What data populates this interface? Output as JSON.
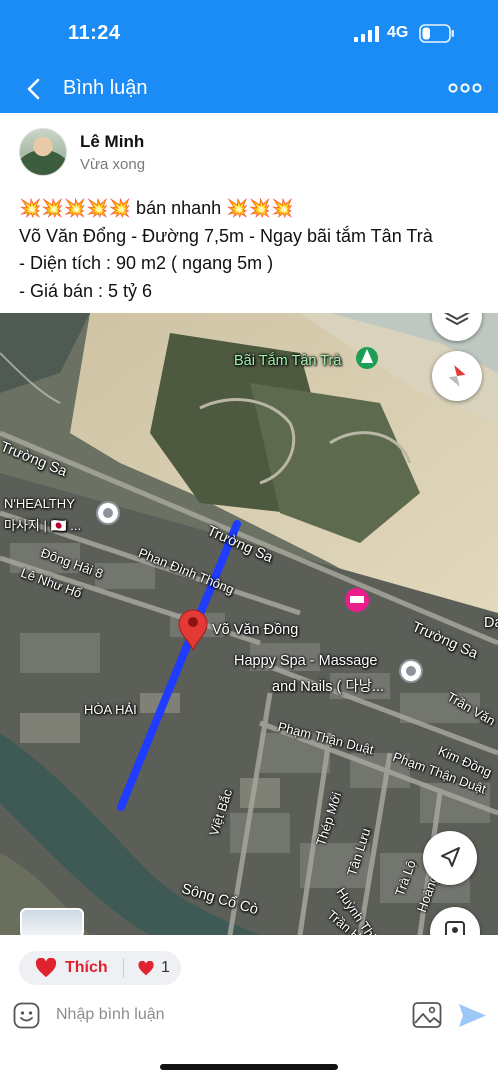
{
  "status_bar": {
    "time": "11:24",
    "network": "4G",
    "battery_level": 0.3
  },
  "header": {
    "title": "Bình luận",
    "back_icon": "chevron-left-icon",
    "more_icon": "more-dots-icon",
    "background": "#1b8cf5"
  },
  "post": {
    "author": "Lê Minh",
    "time": "Vừa xong",
    "lines": [
      "💥💥💥💥💥 bán nhanh 💥💥💥",
      "Võ Văn Đổng - Đường 7,5m - Ngay bãi tắm Tân Trà",
      "- Diện tích : 90 m2 ( ngang 5m )",
      "- Giá bán : 5 tỷ 6"
    ]
  },
  "map": {
    "labels": {
      "beach": "Bãi Tắm Tân Trà",
      "truong_sa_1": "Trường Sa",
      "truong_sa_2": "Trường Sa",
      "truong_sa_3": "Trường Sa",
      "nhealthy_1": "N'HEALTHY",
      "nhealthy_2": "마사지 | 🇯🇵 ...",
      "dong_hai": "Đông Hải 8",
      "le_nhu_ho": "Lê Như Hổ",
      "phan_dinh_thong": "Phan Đình Thông",
      "vo_van_dong": "Võ Văn Đồng",
      "happy_spa_1": "Happy Spa - Massage",
      "happy_spa_2": "and Nails ( 다낭...",
      "hoa_hai": "HÒA HẢI",
      "pham_than_duat_1": "Phạm Thận Duật",
      "pham_than_duat_2": "Phạm Thận Duật",
      "kim_dong": "Kim Đồng",
      "tran_van": "Trần Văn",
      "viet_bac": "Việt Bắc",
      "thep_moi": "Thép Mới",
      "tan_luu": "Tân Lưu",
      "song_co_co": "Sông Cổ Cò",
      "huynh_thi": "Huỳnh Thị M",
      "tran_huu": "Trần Hữu",
      "tra_lo": "Trà Lộ",
      "hoang": "Hoàng",
      "da": "Da"
    },
    "icons": [
      "layers-icon",
      "compass-icon",
      "navigate-icon",
      "scan-icon",
      "map-pin-icon"
    ],
    "route_color": "#1f3cff",
    "pin_color": "#e53935"
  },
  "reactions": {
    "like_label": "Thích",
    "count": "1",
    "like_color": "#e0222f"
  },
  "comment_bar": {
    "placeholder": "Nhập bình luận",
    "emoji_icon": "smiley-icon",
    "image_icon": "image-icon",
    "send_icon": "send-icon"
  }
}
